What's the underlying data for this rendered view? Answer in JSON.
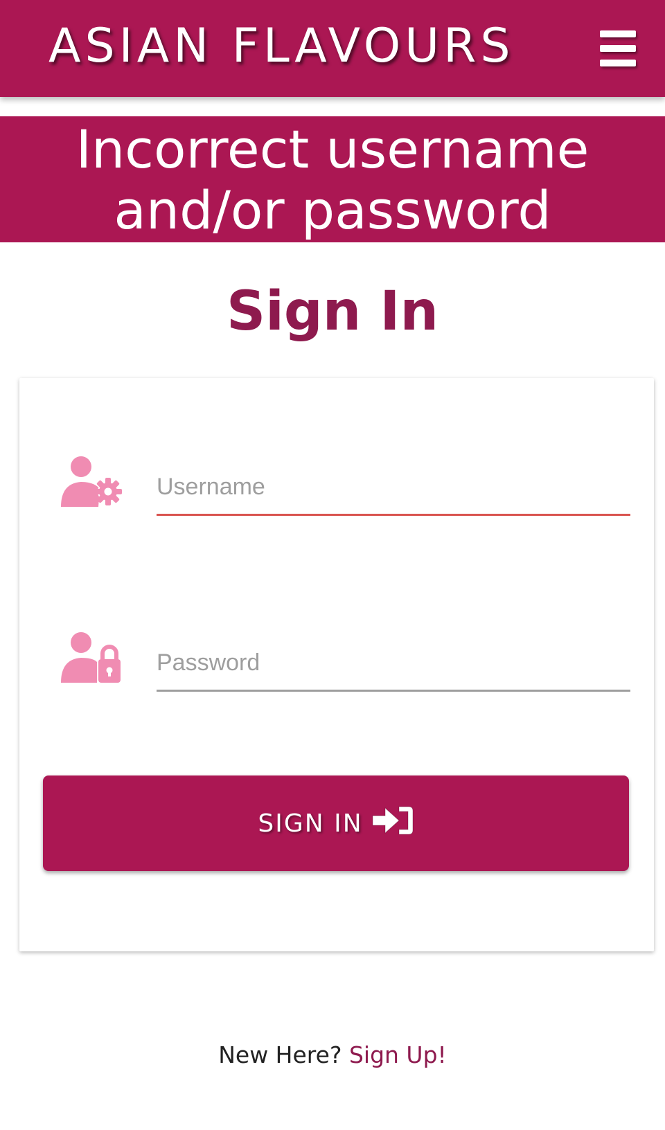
{
  "header": {
    "brand": "ASIAN FLAVOURS",
    "menu_icon": "hamburger-menu-icon",
    "background_color": "#ab1753"
  },
  "alert": {
    "line1": "Incorrect username",
    "line2": "and/or password"
  },
  "page": {
    "title": "Sign In"
  },
  "form": {
    "username": {
      "placeholder": "Username",
      "value": "",
      "icon": "user-gear-icon",
      "underline_color": "#d9534f"
    },
    "password": {
      "placeholder": "Password",
      "value": "",
      "icon": "user-lock-icon",
      "underline_color": "#9e9e9e"
    },
    "submit": {
      "label": "SIGN IN",
      "icon": "sign-in-icon"
    }
  },
  "footer": {
    "prompt": "New Here?",
    "link_label": "Sign Up!"
  },
  "colors": {
    "accent": "#ab1753",
    "title": "#8e1a4e",
    "icon": "#f08cb2"
  }
}
